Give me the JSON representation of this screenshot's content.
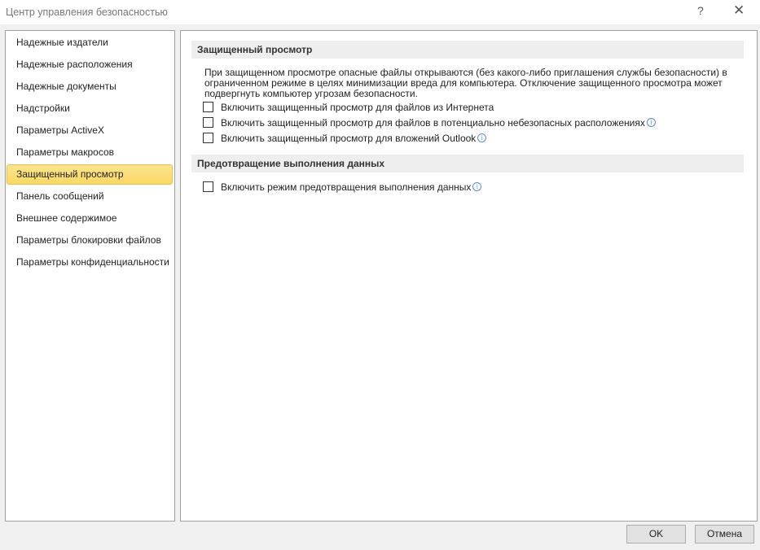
{
  "window": {
    "title": "Центр управления безопасностью",
    "help": "?",
    "close": "✕"
  },
  "sidebar": {
    "items": [
      {
        "label": "Надежные издатели"
      },
      {
        "label": "Надежные расположения"
      },
      {
        "label": "Надежные документы"
      },
      {
        "label": "Надстройки"
      },
      {
        "label": "Параметры ActiveX"
      },
      {
        "label": "Параметры макросов"
      },
      {
        "label": "Защищенный просмотр",
        "selected": true
      },
      {
        "label": "Панель сообщений"
      },
      {
        "label": "Внешнее содержимое"
      },
      {
        "label": "Параметры блокировки файлов"
      },
      {
        "label": "Параметры конфиденциальности"
      }
    ]
  },
  "protected_view": {
    "heading": "Защищенный просмотр",
    "description": "При защищенном просмотре опасные файлы открываются (без какого-либо приглашения службы безопасности) в ограниченном режиме в целях минимизации вреда для компьютера. Отключение защищенного просмотра может подвергнуть компьютер угрозам безопасности.",
    "options": [
      {
        "label": "Включить защищенный просмотр для файлов из Интернета",
        "checked": false
      },
      {
        "label": "Включить защищенный просмотр для файлов в потенциально небезопасных расположениях",
        "checked": false,
        "info": true
      },
      {
        "label": "Включить защищенный просмотр для вложений Outlook",
        "checked": false,
        "info": true
      }
    ]
  },
  "dep": {
    "heading": "Предотвращение выполнения данных",
    "options": [
      {
        "label": "Включить режим предотвращения выполнения данных",
        "checked": false,
        "info": true
      }
    ]
  },
  "buttons": {
    "ok": "OK",
    "cancel": "Отмена"
  },
  "info_glyph": "i"
}
